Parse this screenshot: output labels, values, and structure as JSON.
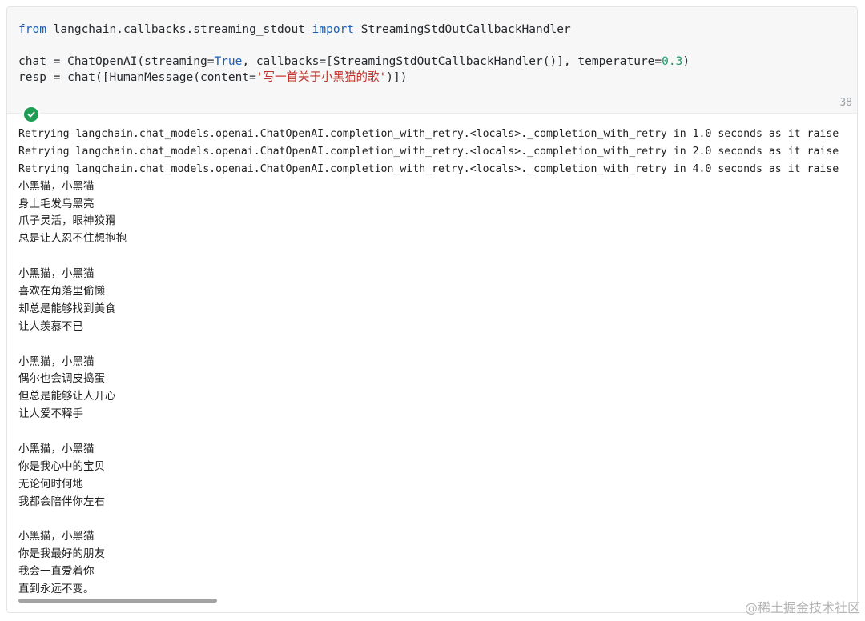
{
  "code": {
    "line1": {
      "kw_from": "from",
      "module": " langchain.callbacks.streaming_stdout ",
      "kw_import": "import",
      "name": " StreamingStdOutCallbackHandler"
    },
    "line3": {
      "a": "chat = ChatOpenAI(streaming=",
      "bool": "True",
      "b": ", callbacks=[StreamingStdOutCallbackHandler()], temperature=",
      "num": "0.3",
      "c": ")"
    },
    "line4": {
      "a": "resp = chat([HumanMessage(content=",
      "str": "'写一首关于小黑猫的歌'",
      "b": ")])"
    }
  },
  "cell": {
    "execution_count": "38",
    "status": "success"
  },
  "output": {
    "retry_lines": [
      "Retrying langchain.chat_models.openai.ChatOpenAI.completion_with_retry.<locals>._completion_with_retry in 1.0 seconds as it raise",
      "Retrying langchain.chat_models.openai.ChatOpenAI.completion_with_retry.<locals>._completion_with_retry in 2.0 seconds as it raise",
      "Retrying langchain.chat_models.openai.ChatOpenAI.completion_with_retry.<locals>._completion_with_retry in 4.0 seconds as it raise"
    ],
    "lyrics": [
      "小黑猫，小黑猫",
      "身上毛发乌黑亮",
      "爪子灵活，眼神狡猾",
      "总是让人忍不住想抱抱",
      "",
      "小黑猫，小黑猫",
      "喜欢在角落里偷懒",
      "却总是能够找到美食",
      "让人羡慕不已",
      "",
      "小黑猫，小黑猫",
      "偶尔也会调皮捣蛋",
      "但总是能够让人开心",
      "让人爱不释手",
      "",
      "小黑猫，小黑猫",
      "你是我心中的宝贝",
      "无论何时何地",
      "我都会陪伴你左右",
      "",
      "小黑猫，小黑猫",
      "你是我最好的朋友",
      "我会一直爱着你",
      "直到永远不变。"
    ]
  },
  "watermark": "@稀土掘金技术社区"
}
